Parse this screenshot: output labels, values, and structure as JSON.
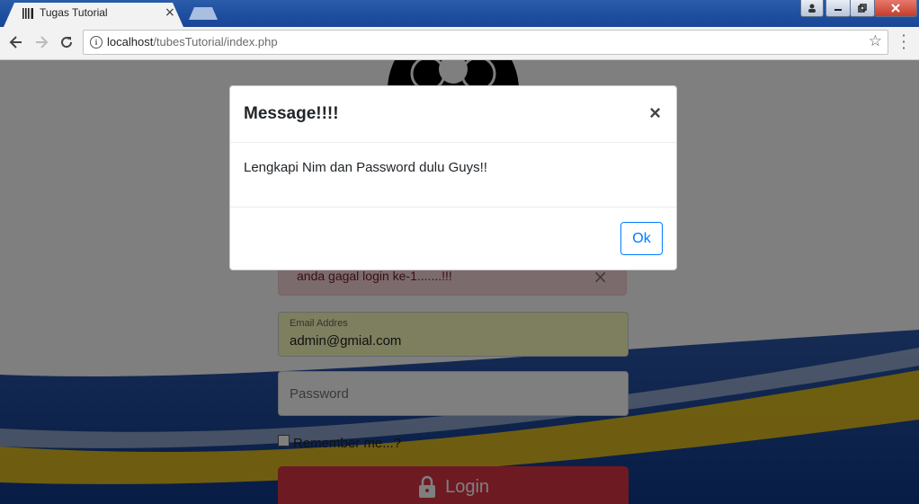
{
  "browser": {
    "tab_title": "Tugas Tutorial",
    "tab_close": "×",
    "url_host": "localhost",
    "url_path": "/tubesTutorial/index.php",
    "window_buttons": [
      "user",
      "minimize",
      "restore",
      "close"
    ]
  },
  "page": {
    "alert_text": "anda gagal login ke-1.......!!!",
    "alert_close": "×",
    "email_label": "Email Addres",
    "email_value": "admin@gmial.com",
    "password_placeholder": "Password",
    "remember_label": "Remember me...?",
    "login_label": "Login",
    "colors": {
      "login_button": "#dc3545",
      "alert_bg": "#f8d7da",
      "autofill_bg": "#faffbd"
    }
  },
  "modal": {
    "title": "Message!!!!",
    "close_symbol": "×",
    "body": "Lengkapi Nim dan Password dulu Guys!!",
    "ok_label": "Ok",
    "accent": "#007bff"
  }
}
